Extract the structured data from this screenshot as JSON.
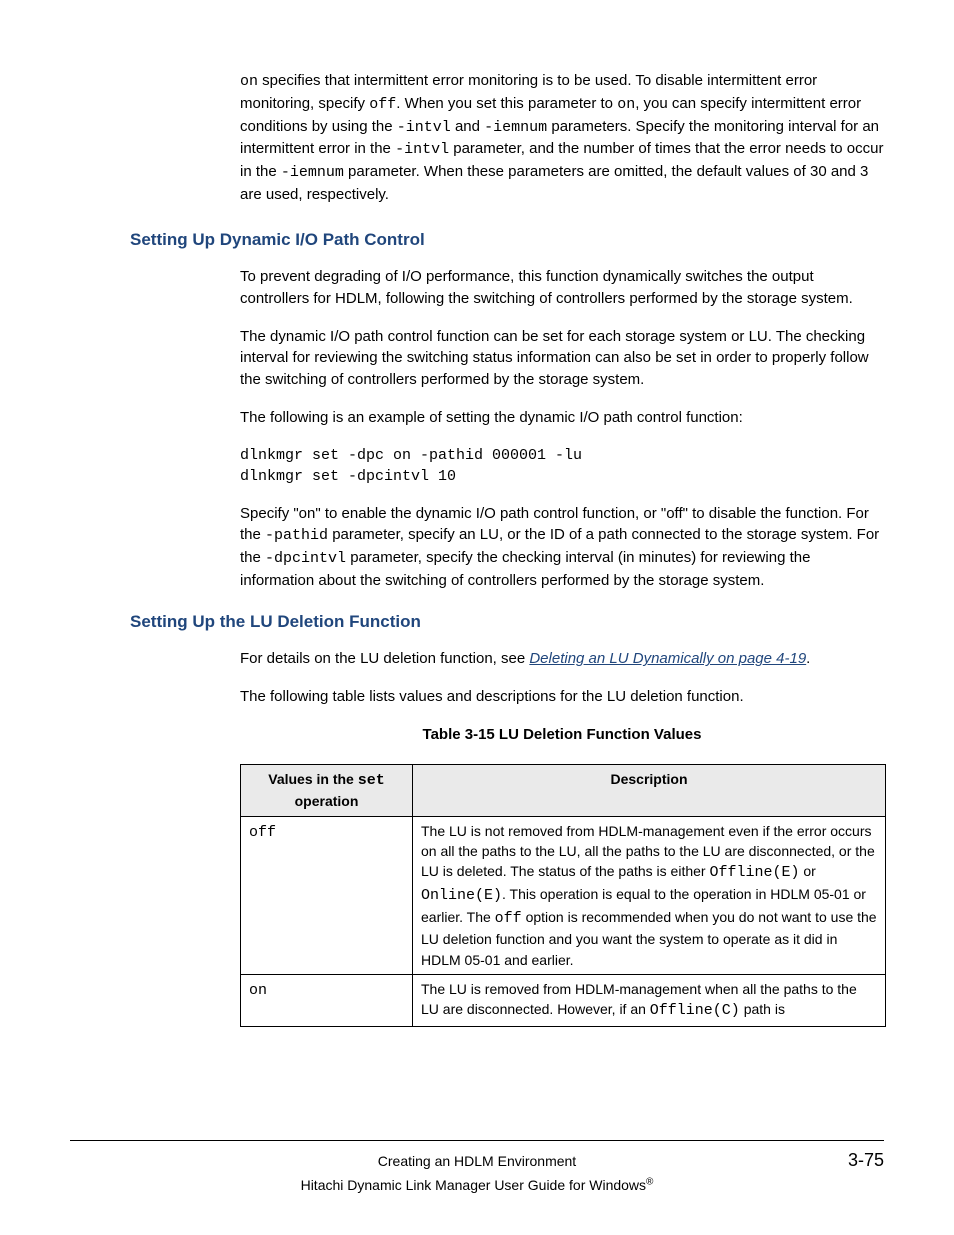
{
  "intro_paragraph": {
    "seg1a": "on",
    "seg1b": " specifies that intermittent error monitoring is to be used. To disable intermittent error monitoring, specify ",
    "seg2a": "off",
    "seg2b": ". When you set this parameter to ",
    "seg3a": "on",
    "seg3b": ", you can specify intermittent error conditions by using the ",
    "seg4a": "-intvl",
    "seg4b": " and ",
    "seg5a": "-iemnum",
    "seg5b": " parameters. Specify the monitoring interval for an intermittent error in the ",
    "seg6a": "-intvl",
    "seg6b": " parameter, and the number of times that the error needs to occur in the ",
    "seg7a": "-iemnum",
    "seg7b": " parameter. When these parameters are omitted, the default values of 30 and 3 are used, respectively."
  },
  "sections": {
    "dynamic": {
      "heading": "Setting Up Dynamic I/O Path Control",
      "p1": "To prevent degrading of I/O performance, this function dynamically switches the output controllers for HDLM, following the switching of controllers performed by the storage system.",
      "p2": "The dynamic I/O path control function can be set for each storage system or LU. The checking interval for reviewing the switching status information can also be set in order to properly follow the switching of controllers performed by the storage system.",
      "p3": "The following is an example of setting the dynamic I/O path control function:",
      "code": "dlnkmgr set -dpc on -pathid 000001 -lu\ndlnkmgr set -dpcintvl 10",
      "p4": {
        "seg1": "Specify \"on\" to enable the dynamic I/O path control function, or \"off\" to disable the function. For the ",
        "seg2a": "-pathid",
        "seg2b": " parameter, specify an LU, or the ID of a path connected to the storage system. For the ",
        "seg3a": "-dpcintvl",
        "seg3b": " parameter, specify the checking interval (in minutes) for reviewing the information about the switching of controllers performed by the storage system."
      }
    },
    "lu": {
      "heading": "Setting Up the LU Deletion Function",
      "p1a": "For details on the LU deletion function, see ",
      "p1_link": "Deleting an LU Dynamically on page 4-19",
      "p1b": ".",
      "p2": "The following table lists values and descriptions for the LU deletion function.",
      "table_caption": "Table 3-15 LU Deletion Function Values",
      "table": {
        "head_col1a": "Values in the ",
        "head_col1b": "set",
        "head_col1c": " operation",
        "head_col2": "Description",
        "rows": [
          {
            "value": "off",
            "desc": {
              "seg1": "The LU is not removed from HDLM-management even if the error occurs on all the paths to the LU, all the paths to the LU are disconnected, or the LU is deleted. The status of the paths is either ",
              "seg2a": "Offline(E)",
              "seg2b": " or ",
              "seg3a": "Online(E)",
              "seg3b": ". This operation is equal to the operation in HDLM 05-01 or earlier. The ",
              "seg4a": "off",
              "seg4b": " option is recommended when you do not want to use the LU deletion function and you want the system to operate as it did in HDLM 05-01 and earlier."
            }
          },
          {
            "value": "on",
            "desc": {
              "seg1": "The LU is removed from HDLM-management when all the paths to the LU are disconnected. However, if an ",
              "seg2a": "Offline(C)",
              "seg2b": " path is"
            }
          }
        ]
      }
    }
  },
  "footer": {
    "chapter": "Creating an HDLM Environment",
    "page": "3-75",
    "book": "Hitachi Dynamic Link Manager User Guide for Windows",
    "reg": "®"
  }
}
